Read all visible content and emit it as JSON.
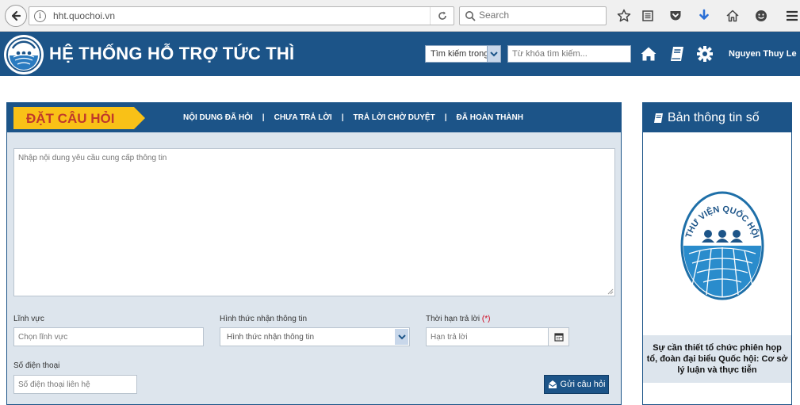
{
  "browser": {
    "url": "hht.quochoi.vn",
    "search_placeholder": "Search"
  },
  "header": {
    "title": "HỆ THỐNG HỖ TRỢ TỨC THÌ",
    "search_scope": "Tìm kiếm trong",
    "keyword_placeholder": "Từ khóa tìm kiếm...",
    "user_name": "Nguyen Thuy Le"
  },
  "main": {
    "ask_label": "ĐẶT CÂU HỎI",
    "tabs": [
      {
        "label": "NỘI DUNG ĐÃ HỎI"
      },
      {
        "label": "CHƯA TRẢ LỜI"
      },
      {
        "label": "TRẢ LỜI CHỜ DUYỆT"
      },
      {
        "label": "ĐÃ HOÀN THÀNH"
      }
    ],
    "separator": "|",
    "question_placeholder": "Nhập nội dung yêu cầu cung cấp thông tin",
    "field_domain": {
      "label": "Lĩnh vực",
      "placeholder": "Chọn lĩnh vực"
    },
    "field_method": {
      "label": "Hình thức nhận thông tin",
      "value": "Hình thức nhận thông tin"
    },
    "field_deadline": {
      "label": "Thời hạn trả lời",
      "required_mark": "(*)",
      "placeholder": "Hạn trả lời"
    },
    "field_phone": {
      "label": "Số điện thoại",
      "placeholder": "Số điện thoại liên hệ"
    },
    "send_label": "Gửi câu hỏi"
  },
  "side": {
    "title": "Bản thông tin số",
    "caption": "Sự cần thiết tổ chức phiên họp tổ, đoàn đại biểu Quốc hội: Cơ sở lý luận và thực tiễn",
    "logo_text": "THƯ VIỆN QUỐC HỘI"
  },
  "colors": {
    "brand": "#1c5488",
    "accent": "#f9c117",
    "accent_text": "#c0392b"
  }
}
